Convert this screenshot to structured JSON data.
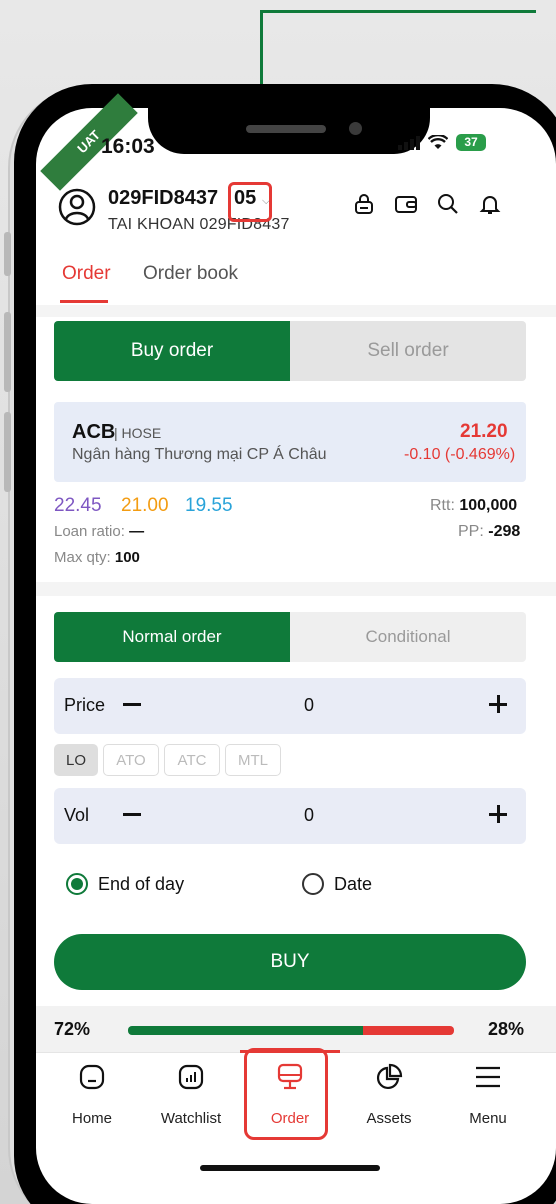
{
  "status_bar": {
    "badge": "UAT",
    "time": "16:03",
    "battery": "37"
  },
  "account": {
    "number": "029FID8437",
    "sub_account": "05",
    "name": "TAI KHOAN 029FID8437"
  },
  "tabs": [
    {
      "label": "Order"
    },
    {
      "label": "Order book"
    }
  ],
  "side_tabs": {
    "buy": "Buy order",
    "sell": "Sell order"
  },
  "quote": {
    "symbol": "ACB",
    "exchange": "| HOSE",
    "name": "Ngân hàng Thương mại CP Á Châu",
    "price": "21.20",
    "change": "-0.10 (-0.469%)",
    "ceiling": "22.45",
    "reference": "21.00",
    "floor": "19.55",
    "rtt_label": "Rtt:",
    "rtt_value": "100,000",
    "loan_label": "Loan ratio:",
    "loan_value": "—",
    "pp_label": "PP:",
    "pp_value": "-298",
    "maxqty_label": "Max qty:",
    "maxqty_value": "100"
  },
  "order_type_tabs": {
    "normal": "Normal order",
    "conditional": "Conditional"
  },
  "price_row": {
    "label": "Price",
    "value": "0"
  },
  "price_types": [
    "LO",
    "ATO",
    "ATC",
    "MTL"
  ],
  "vol_row": {
    "label": "Vol",
    "value": "0"
  },
  "validity": {
    "end_of_day": "End of day",
    "date": "Date"
  },
  "buy_button": "BUY",
  "ratio": {
    "buy_pct": "72%",
    "sell_pct": "28%",
    "buy_fraction": 0.72
  },
  "nav": [
    {
      "label": "Home"
    },
    {
      "label": "Watchlist"
    },
    {
      "label": "Order"
    },
    {
      "label": "Assets"
    },
    {
      "label": "Menu"
    }
  ],
  "colors": {
    "primary_green": "#0f7a3a",
    "accent_red": "#e53935",
    "ceiling_purple": "#7e57c2",
    "ref_orange": "#f39c12",
    "floor_cyan": "#29a3d9"
  }
}
